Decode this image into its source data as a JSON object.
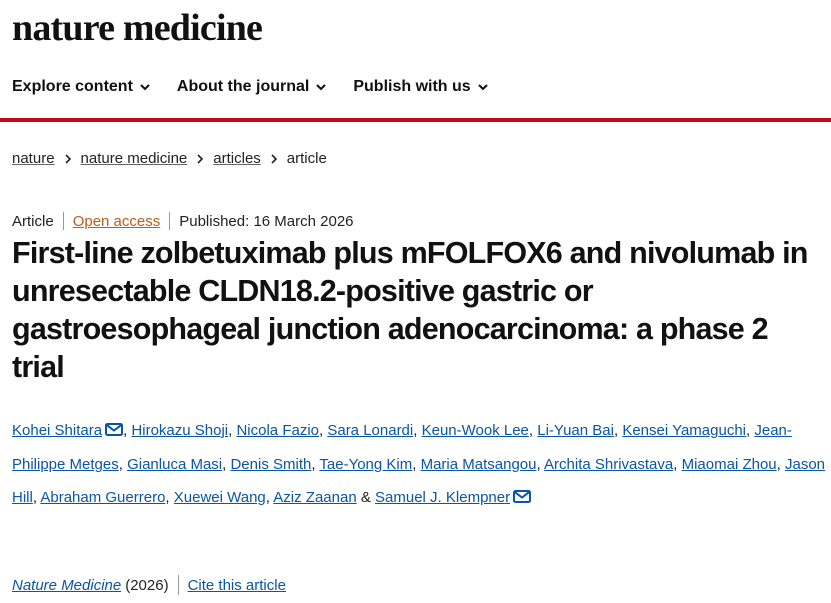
{
  "site": {
    "logo": "nature medicine"
  },
  "nav": [
    {
      "label": "Explore content"
    },
    {
      "label": "About the journal"
    },
    {
      "label": "Publish with us"
    }
  ],
  "breadcrumb": [
    {
      "label": "nature"
    },
    {
      "label": "nature medicine"
    },
    {
      "label": "articles"
    },
    {
      "label": "article"
    }
  ],
  "article": {
    "type": "Article",
    "access": "Open access",
    "published": "Published: 16 March 2026",
    "title": "First-line zolbetuximab plus mFOLFOX6 and nivolumab in unresectable CLDN18.2-positive gastric or gastroesophageal junction adenocarcinoma: a phase 2 trial",
    "authors": [
      "Kohei Shitara",
      "Hirokazu Shoji",
      "Nicola Fazio",
      "Sara Lonardi",
      "Keun-Wook Lee",
      "Li-Yuan Bai",
      "Kensei Yamaguchi",
      "Jean-Philippe Metges",
      "Gianluca Masi",
      "Denis Smith",
      "Tae-Yong Kim",
      "Maria Matsangou",
      "Archita Shrivastava",
      "Miaomai Zhou",
      "Jason Hill",
      "Abraham Guerrero",
      "Xuewei Wang",
      "Aziz Zaanan",
      "Samuel J. Klempner"
    ],
    "and_text": "&",
    "journal": "Nature Medicine",
    "year": "(2026)",
    "cite": "Cite this article"
  },
  "colors": {
    "brand_red": "#c00a1a",
    "link_blue": "#0a55a6",
    "open_access": "#c05a1b"
  }
}
